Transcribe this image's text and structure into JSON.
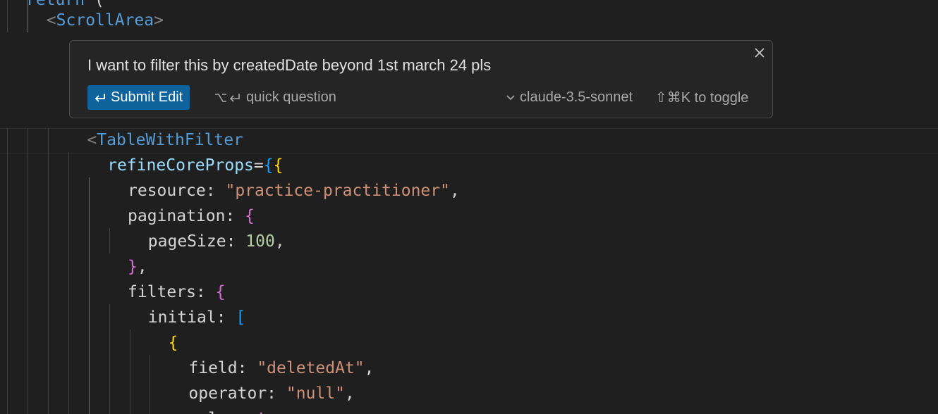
{
  "editor": {
    "lines": [
      {
        "indent": "",
        "parts": [
          {
            "cls": "tok-comp-blue",
            "text": "return"
          },
          {
            "cls": "tok-punct",
            "text": " ("
          }
        ]
      },
      {
        "indent": "  ",
        "parts": [
          {
            "cls": "tok-tag",
            "text": "<"
          },
          {
            "cls": "tok-comp-blue",
            "text": "ScrollArea"
          },
          {
            "cls": "tok-tag",
            "text": ">"
          }
        ]
      },
      {
        "indent": "      ",
        "parts": [
          {
            "cls": "tok-tag",
            "text": "<"
          },
          {
            "cls": "tok-comp-blue",
            "text": "TableWithFilter"
          }
        ]
      },
      {
        "indent": "        ",
        "parts": [
          {
            "cls": "tok-attr",
            "text": "refineCoreProps"
          },
          {
            "cls": "tok-punct",
            "text": "="
          },
          {
            "cls": "tok-brace-b",
            "text": "{"
          },
          {
            "cls": "tok-brace-y",
            "text": "{"
          }
        ]
      },
      {
        "indent": "          ",
        "parts": [
          {
            "cls": "tok-key",
            "text": "resource: "
          },
          {
            "cls": "tok-str",
            "text": "\"practice-practitioner\""
          },
          {
            "cls": "tok-punct",
            "text": ","
          }
        ]
      },
      {
        "indent": "          ",
        "parts": [
          {
            "cls": "tok-key",
            "text": "pagination: "
          },
          {
            "cls": "tok-brace-p",
            "text": "{"
          }
        ]
      },
      {
        "indent": "            ",
        "parts": [
          {
            "cls": "tok-key",
            "text": "pageSize: "
          },
          {
            "cls": "tok-num",
            "text": "100"
          },
          {
            "cls": "tok-punct",
            "text": ","
          }
        ]
      },
      {
        "indent": "          ",
        "parts": [
          {
            "cls": "tok-brace-p",
            "text": "}"
          },
          {
            "cls": "tok-punct",
            "text": ","
          }
        ]
      },
      {
        "indent": "          ",
        "parts": [
          {
            "cls": "tok-key",
            "text": "filters: "
          },
          {
            "cls": "tok-brace-p",
            "text": "{"
          }
        ]
      },
      {
        "indent": "            ",
        "parts": [
          {
            "cls": "tok-key",
            "text": "initial: "
          },
          {
            "cls": "tok-brace-b",
            "text": "["
          }
        ]
      },
      {
        "indent": "              ",
        "parts": [
          {
            "cls": "tok-brace-y",
            "text": "{"
          }
        ]
      },
      {
        "indent": "                ",
        "parts": [
          {
            "cls": "tok-key",
            "text": "field: "
          },
          {
            "cls": "tok-str",
            "text": "\"deletedAt\""
          },
          {
            "cls": "tok-punct",
            "text": ","
          }
        ]
      },
      {
        "indent": "                ",
        "parts": [
          {
            "cls": "tok-key",
            "text": "operator: "
          },
          {
            "cls": "tok-str",
            "text": "\"null\""
          },
          {
            "cls": "tok-punct",
            "text": ","
          }
        ]
      },
      {
        "indent": "                ",
        "parts": [
          {
            "cls": "tok-key",
            "text": "value: "
          },
          {
            "cls": "tok-brace-p",
            "text": "t"
          }
        ]
      }
    ]
  },
  "prompt": {
    "text": "I want to filter this by createdDate beyond 1st march 24 pls",
    "submit_label": "Submit Edit",
    "quick_question_label": "quick question",
    "model_label": "claude-3.5-sonnet",
    "toggle_hint": "⇧⌘K to toggle",
    "accent_color": "#0e639c"
  }
}
